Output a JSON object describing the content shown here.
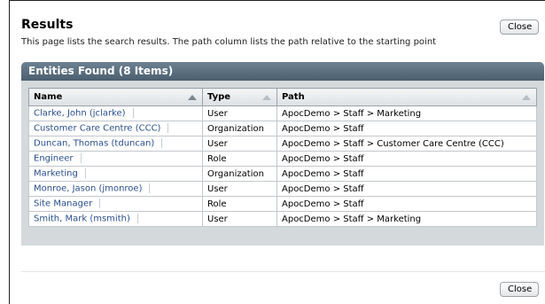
{
  "page": {
    "title": "Results",
    "description": "This page lists the search results. The path column lists the path relative to the starting point",
    "close_label": "Close"
  },
  "panel": {
    "header": "Entities Found (8 Items)"
  },
  "table": {
    "columns": [
      "Name",
      "Type",
      "Path"
    ],
    "rows": [
      {
        "name": "Clarke, John (jclarke)",
        "type": "User",
        "path": "ApocDemo > Staff > Marketing"
      },
      {
        "name": "Customer Care Centre (CCC)",
        "type": "Organization",
        "path": "ApocDemo > Staff"
      },
      {
        "name": "Duncan, Thomas (tduncan)",
        "type": "User",
        "path": "ApocDemo > Staff > Customer Care Centre (CCC)"
      },
      {
        "name": "Engineer",
        "type": "Role",
        "path": "ApocDemo > Staff"
      },
      {
        "name": "Marketing",
        "type": "Organization",
        "path": "ApocDemo > Staff"
      },
      {
        "name": "Monroe, Jason (jmonroe)",
        "type": "User",
        "path": "ApocDemo > Staff"
      },
      {
        "name": "Site Manager",
        "type": "Role",
        "path": "ApocDemo > Staff"
      },
      {
        "name": "Smith, Mark (msmith)",
        "type": "User",
        "path": "ApocDemo > Staff > Marketing"
      }
    ]
  }
}
